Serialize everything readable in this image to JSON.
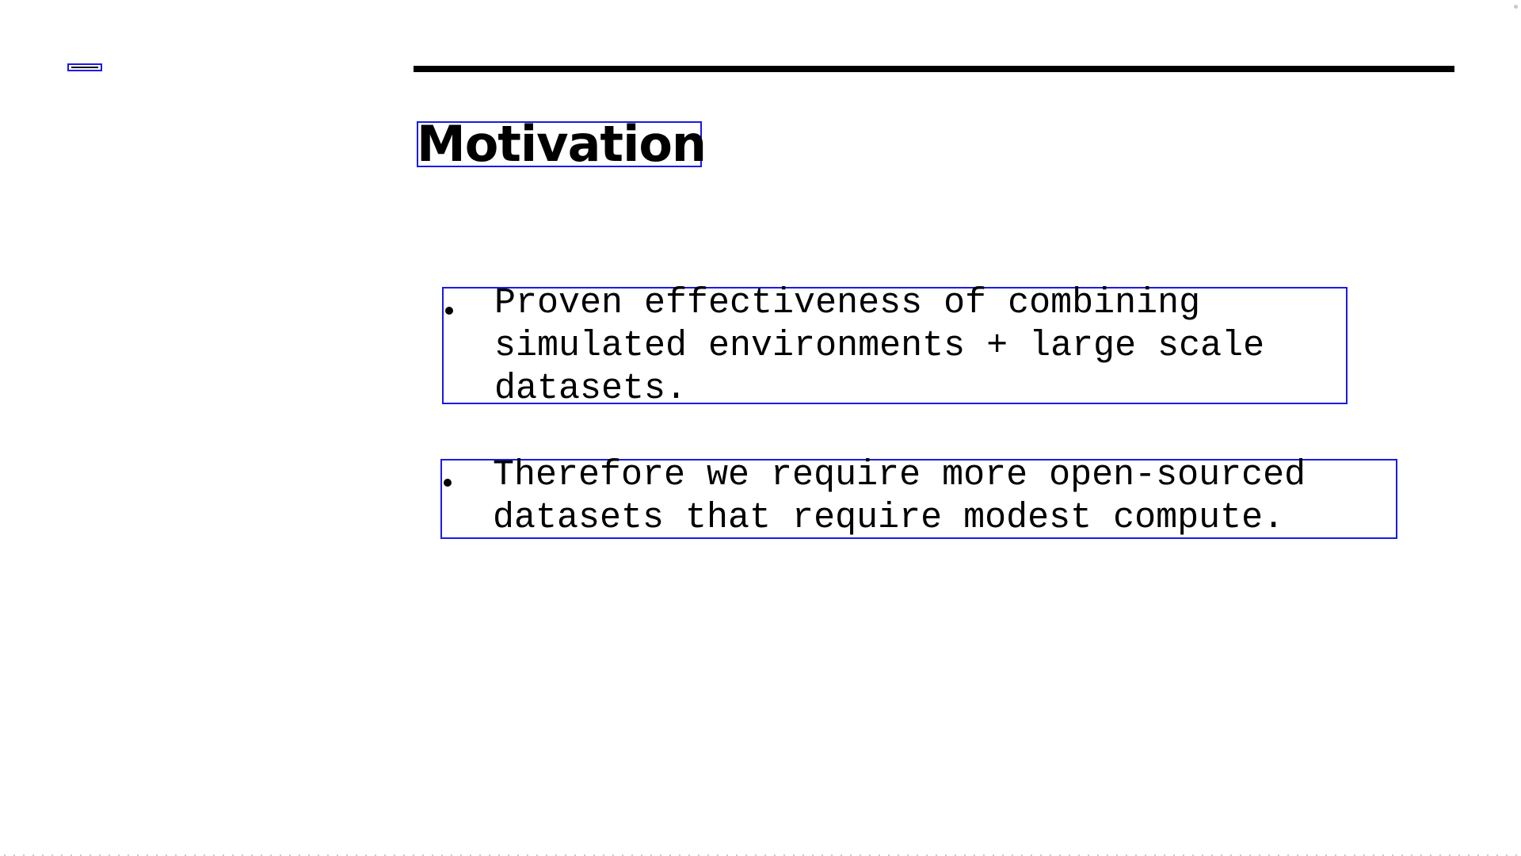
{
  "slide": {
    "title": "Motivation",
    "bullets": [
      {
        "lines": [
          "Proven effectiveness of combining",
          "simulated environments + large scale",
          "datasets."
        ]
      },
      {
        "lines": [
          "Therefore we require more open-sourced",
          "datasets that require modest compute."
        ]
      }
    ]
  },
  "colors": {
    "annotation_box": "#1a1ae6",
    "text": "#000000",
    "background": "#ffffff"
  }
}
